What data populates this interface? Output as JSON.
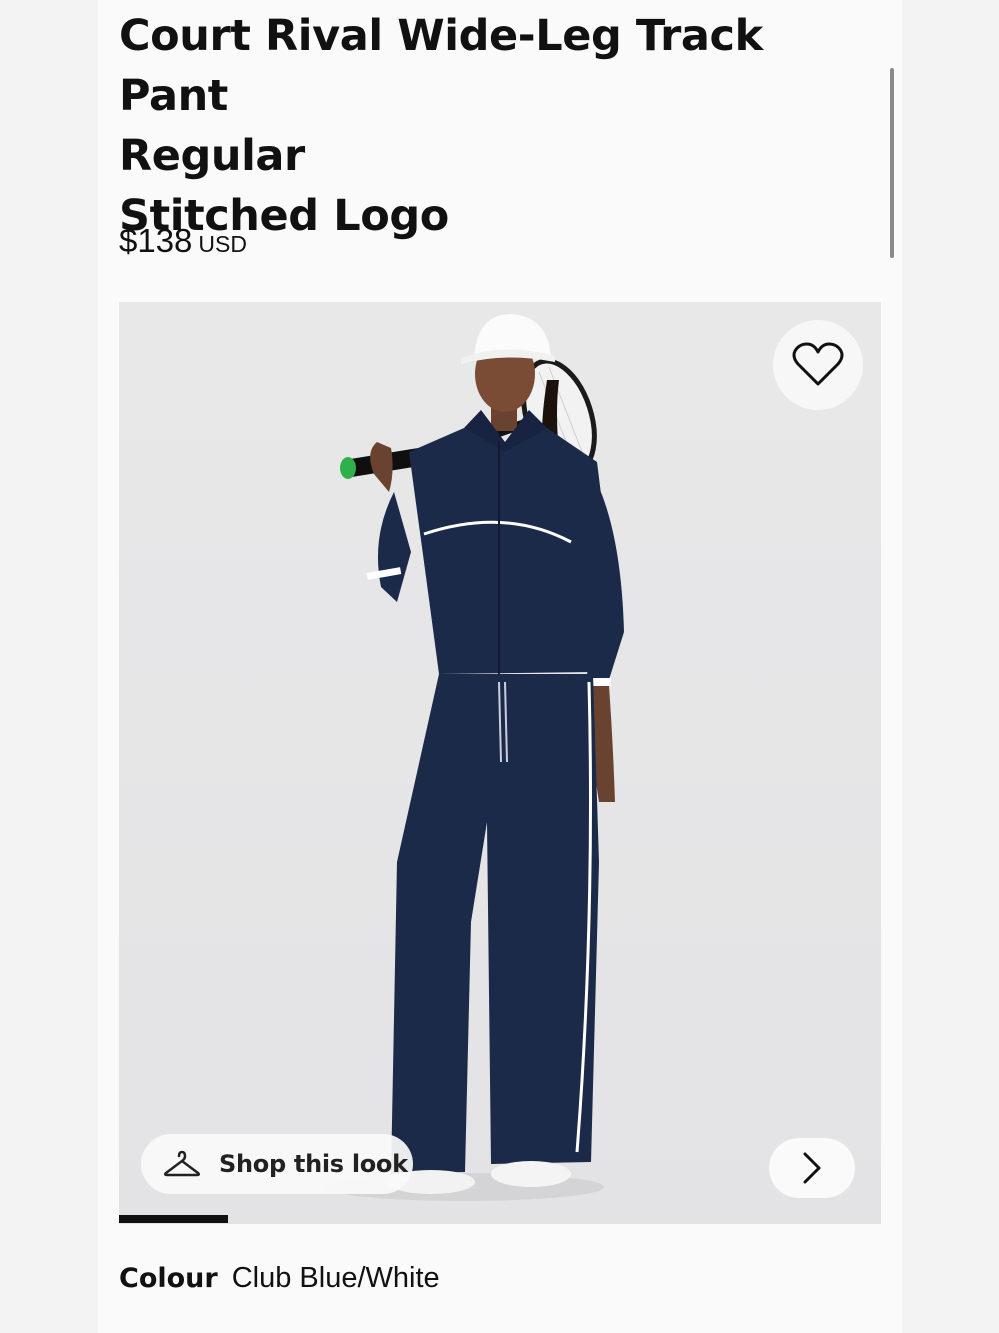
{
  "product": {
    "title_lines": [
      "Court Rival Wide-Leg Track Pant",
      "Regular",
      "Stitched Logo"
    ],
    "price": "$138",
    "currency": "USD"
  },
  "gallery": {
    "shop_this_look_label": "Shop this look",
    "progress_fraction": 0.143,
    "icons": {
      "favorite": "heart-icon",
      "shop_look": "hanger-icon",
      "next": "chevron-right-icon"
    }
  },
  "colour": {
    "label": "Colour",
    "value": "Club Blue/White"
  },
  "colors": {
    "garment": "#1c2a4a",
    "piping": "#ffffff",
    "background": "#e6e6e8"
  }
}
